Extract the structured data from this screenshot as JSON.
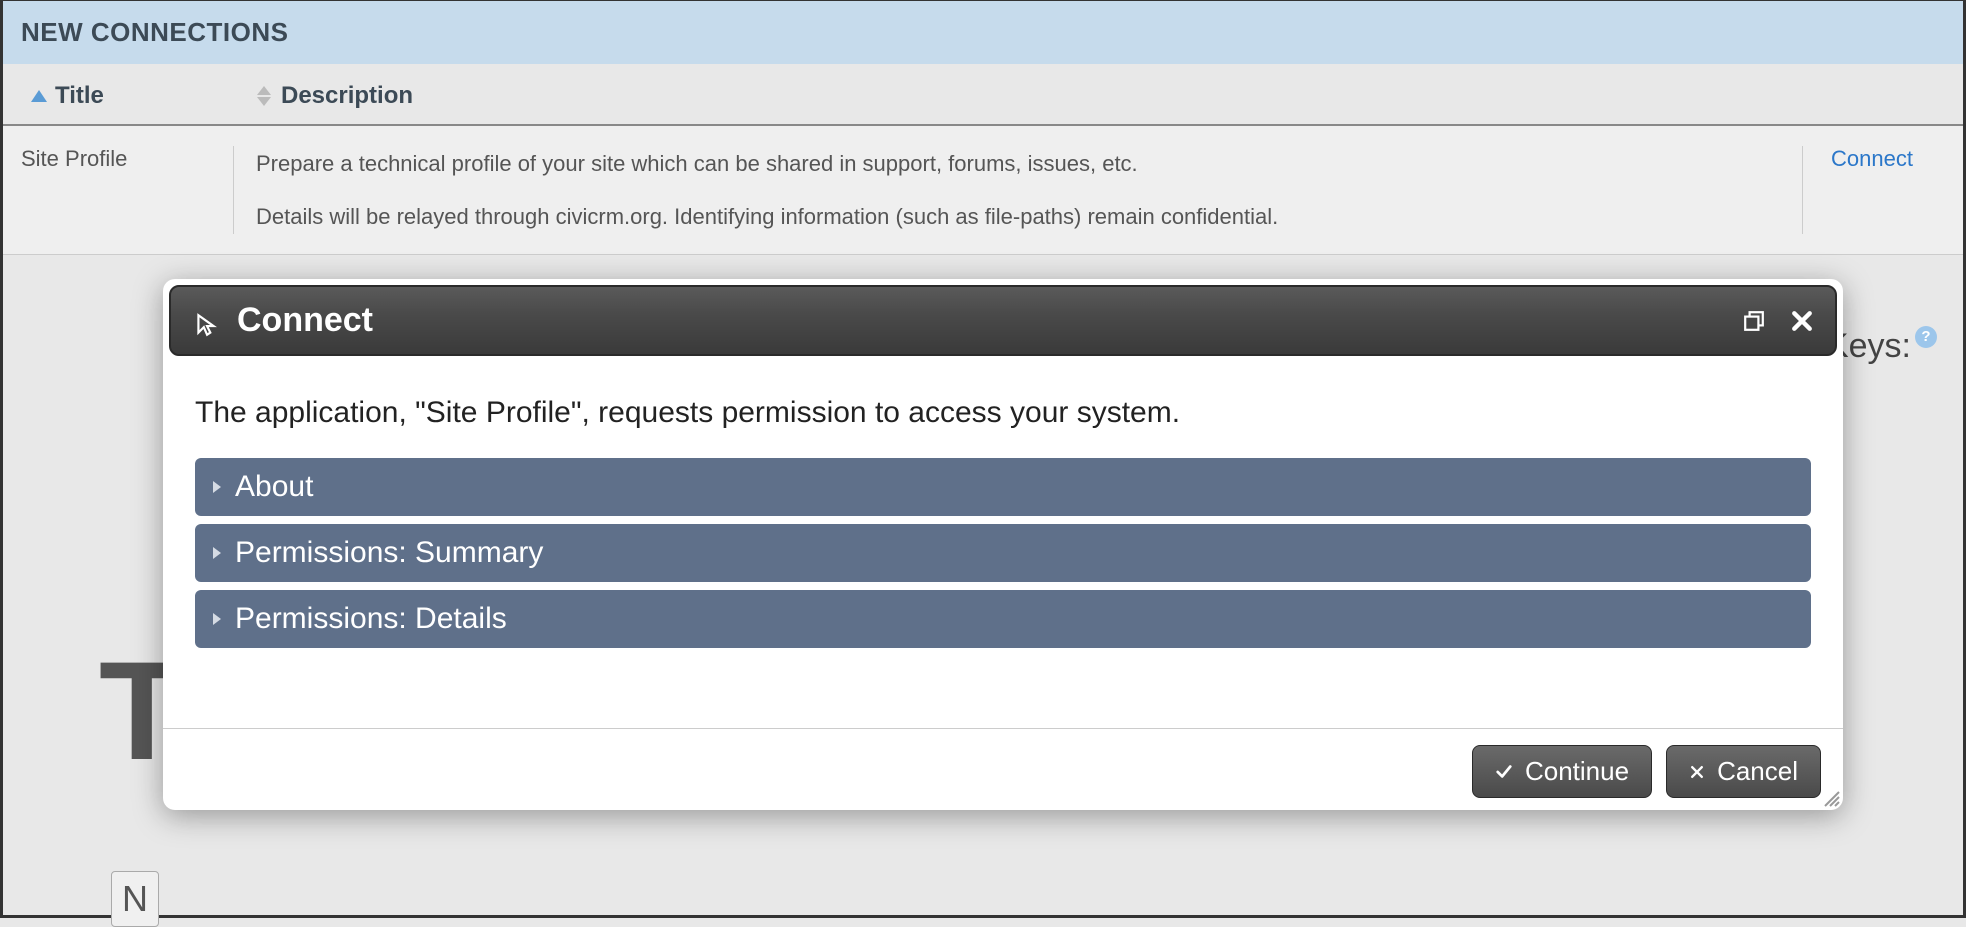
{
  "header": {
    "title": "NEW CONNECTIONS"
  },
  "columns": {
    "title": "Title",
    "description": "Description"
  },
  "row": {
    "title": "Site Profile",
    "desc1": "Prepare a technical profile of your site which can be shared in support, forums, issues, etc.",
    "desc2": "Details will be relayed through civicrm.org. Identifying information (such as file-paths) remain confidential.",
    "action": "Connect"
  },
  "background": {
    "keys_label": "Keys:",
    "help_glyph": "?",
    "t_fragment": "T",
    "n_fragment": "N"
  },
  "modal": {
    "title": "Connect",
    "message": "The application, \"Site Profile\", requests permission to access your system.",
    "accordion": {
      "about": "About",
      "perm_summary": "Permissions: Summary",
      "perm_details": "Permissions: Details"
    },
    "buttons": {
      "continue": "Continue",
      "cancel": "Cancel"
    }
  }
}
